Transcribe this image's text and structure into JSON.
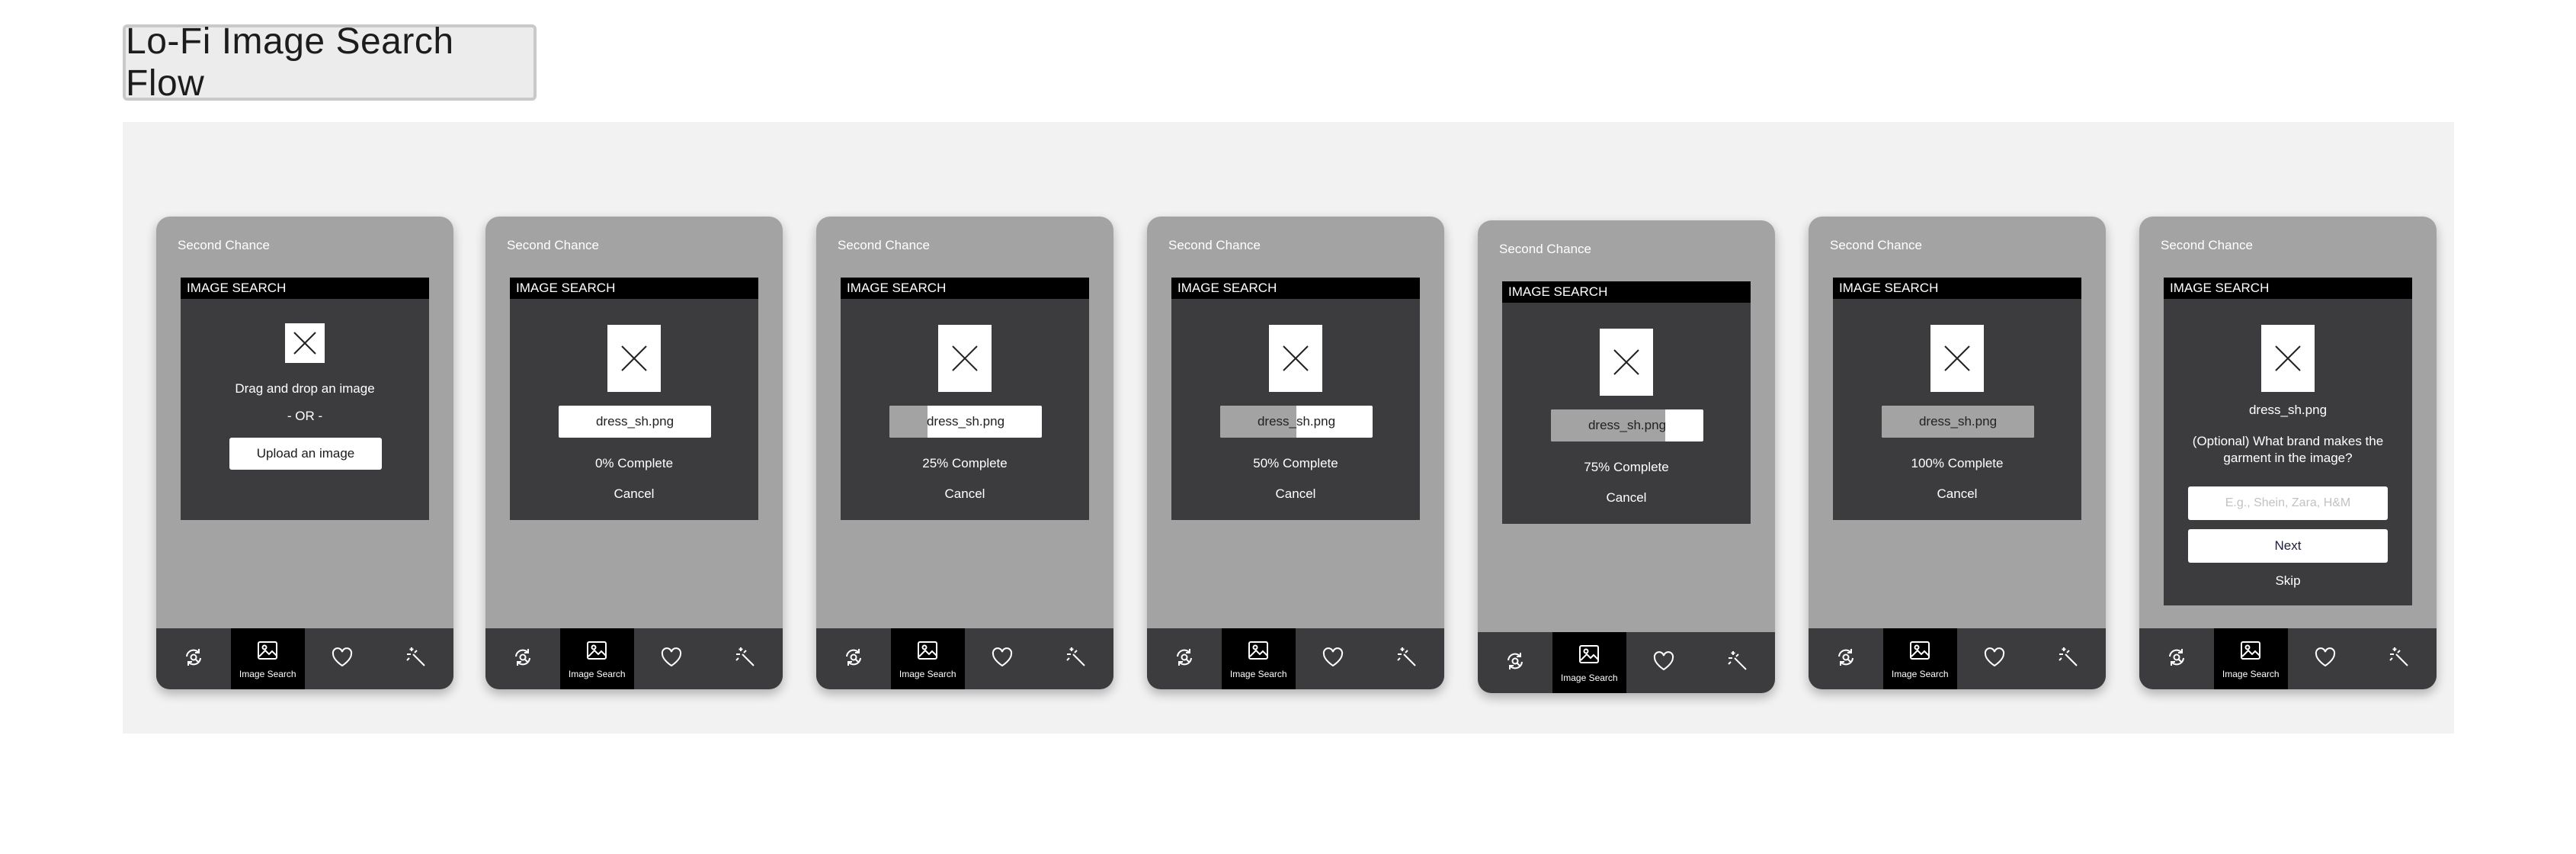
{
  "page_title": "Lo-Fi Image Search Flow",
  "common": {
    "brand": "Second Chance",
    "modal_title": "IMAGE SEARCH",
    "file_name": "dress_sh.png",
    "cancel": "Cancel",
    "nav": [
      {
        "icon": "refresh-search-icon",
        "label": ""
      },
      {
        "icon": "image-icon",
        "label": "Image Search"
      },
      {
        "icon": "heart-icon",
        "label": ""
      },
      {
        "icon": "magic-wand-icon",
        "label": ""
      }
    ]
  },
  "screens": [
    {
      "type": "upload",
      "drag_text": "Drag and drop an image",
      "or_text": "- OR -",
      "upload_label": "Upload an image"
    },
    {
      "type": "progress",
      "progress": 0,
      "status": "0% Complete"
    },
    {
      "type": "progress",
      "progress": 0.25,
      "status": "25% Complete"
    },
    {
      "type": "progress",
      "progress": 0.5,
      "status": "50% Complete"
    },
    {
      "type": "progress",
      "progress": 0.75,
      "status": "75% Complete"
    },
    {
      "type": "progress",
      "progress": 1.0,
      "status": "100% Complete"
    },
    {
      "type": "brand",
      "question": "(Optional) What brand makes the garment in the image?",
      "placeholder": "E.g., Shein, Zara, H&M",
      "next_label": "Next",
      "skip_label": "Skip"
    }
  ]
}
